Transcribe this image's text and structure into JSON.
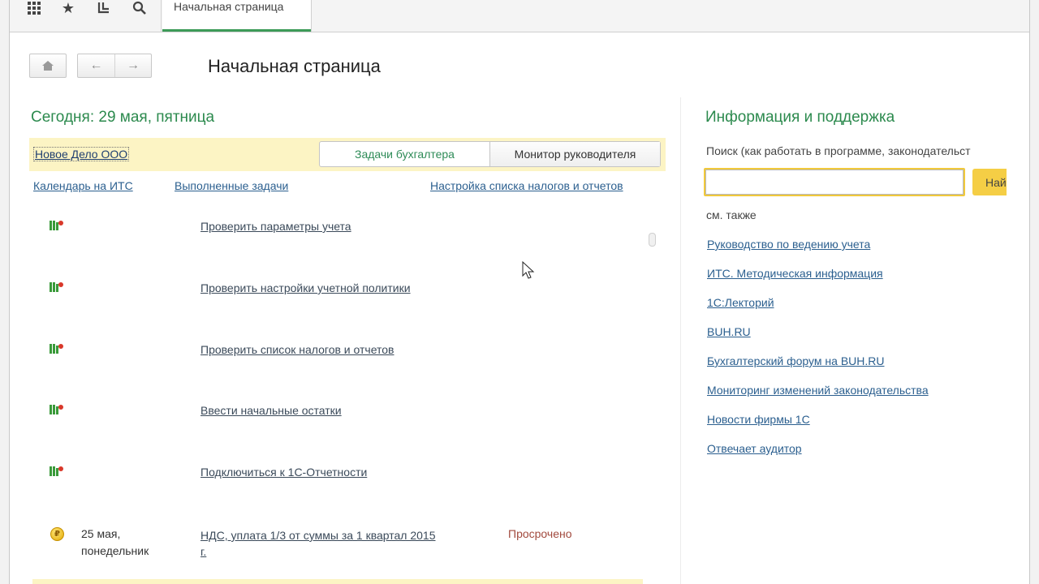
{
  "toolbar": {
    "icons": [
      "apps-grid-icon",
      "favorites-star-icon",
      "history-icon",
      "search-icon"
    ],
    "active_tab": "Начальная страница"
  },
  "header": {
    "title": "Начальная страница",
    "home_icon": "home-icon",
    "back_icon": "arrow-left-icon",
    "forward_icon": "arrow-right-icon"
  },
  "left": {
    "today": "Сегодня: 29 мая, пятница",
    "company": "Новое Дело ООО",
    "switch": {
      "tasks": "Задачи бухгалтера",
      "monitor": "Монитор руководителя",
      "selected": "Монитор руководителя"
    },
    "links": {
      "calendar": "Календарь на ИТС",
      "done": "Выполненные задачи",
      "settings": "Настройка списка налогов и отчетов"
    },
    "tasks": [
      {
        "title": "Проверить параметры учета",
        "icon": "task-flag-icon"
      },
      {
        "title": "Проверить настройки учетной политики",
        "icon": "task-flag-icon"
      },
      {
        "title": "Проверить список налогов и отчетов",
        "icon": "task-flag-icon"
      },
      {
        "title": "Ввести начальные остатки",
        "icon": "task-flag-icon"
      },
      {
        "title": "Подключиться к 1С-Отчетности",
        "icon": "task-flag-icon"
      }
    ],
    "payment_task": {
      "date_line1": "25 мая,",
      "date_line2": "понедельник",
      "title_line1": "НДС, уплата 1/3 от суммы за 1 квартал 2015",
      "title_line2": "г.",
      "status": "Просрочено",
      "icon": "coin-ruble-icon"
    }
  },
  "right": {
    "title": "Информация и поддержка",
    "search_label": "Поиск (как работать в программе, законодательст",
    "search_value": "",
    "find_button": "Найти",
    "see_also": "см. также",
    "links": [
      "Руководство по ведению учета",
      "ИТС. Методическая информация",
      "1С:Лекторий",
      "BUH.RU",
      "Бухгалтерский форум на BUH.RU",
      "Мониторинг изменений законодательства",
      "Новости фирмы 1С",
      "Отвечает аудитор"
    ]
  },
  "colors": {
    "accent_green": "#2c8a4e",
    "highlight_yellow": "#fcf4c4",
    "button_yellow": "#f5ce45",
    "link_blue": "#2b5f8f",
    "overdue_red": "#a24a3e"
  }
}
